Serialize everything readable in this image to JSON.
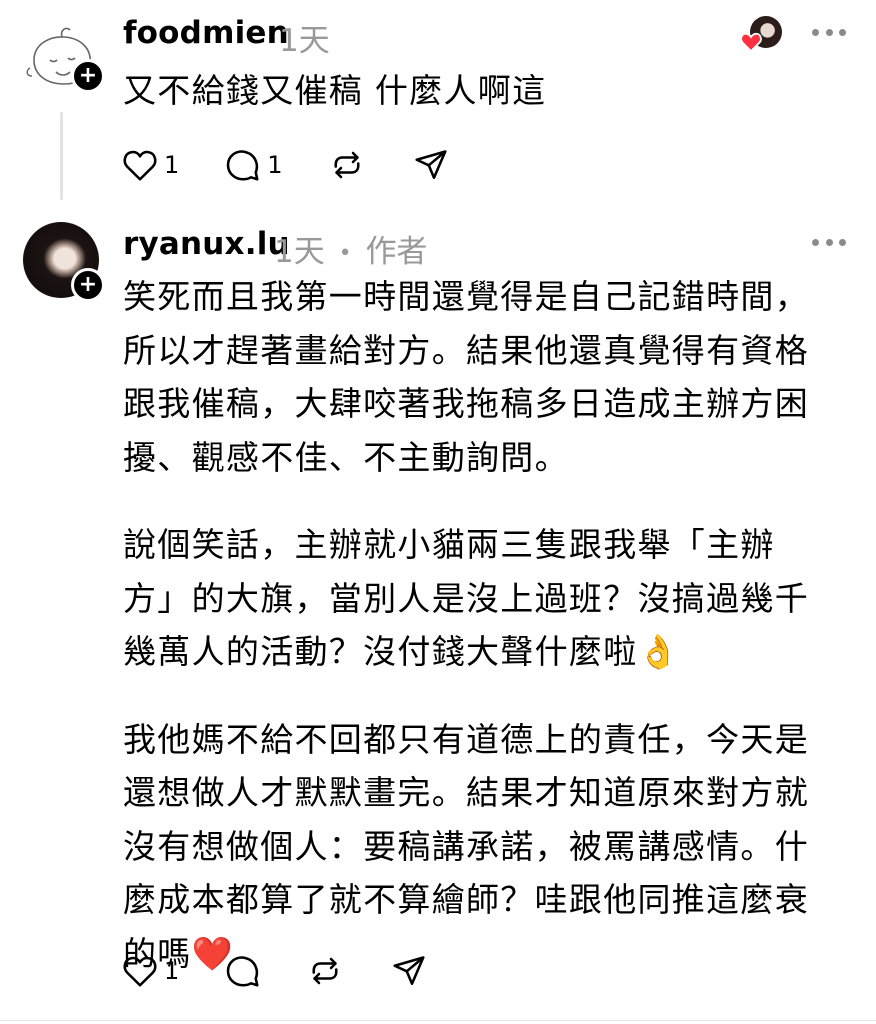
{
  "comment1": {
    "username": "foodmien",
    "time": "1天",
    "text": "又不給錢又催稿 什麼人啊這",
    "likes": "1",
    "replies": "1"
  },
  "comment2": {
    "username": "ryanux.lu",
    "time": "1天",
    "separator": "•",
    "author_badge": "作者",
    "paragraphs": [
      [
        "笑死而且我第一時間還覺得是自己記錯時間，",
        "所以才趕著畫給對方。結果他還真覺得有資格",
        "跟我催稿，大肆咬著我拖稿多日造成主辦方困",
        "擾、觀感不佳、不主動詢問。"
      ],
      [
        "說個笑話，主辦就小貓兩三隻跟我舉「主辦",
        "方」的大旗，當別人是沒上過班？沒搞過幾千",
        "幾萬人的活動？沒付錢大聲什麼啦👌"
      ],
      [
        "我他媽不給不回都只有道德上的責任，今天是",
        "還想做人才默默畫完。結果才知道原來對方就",
        "沒有想做個人：要稿講承諾，被罵講感情。什",
        "麼成本都算了就不算繪師？哇跟他同推這麼衰",
        "的嗎❤️"
      ]
    ],
    "likes": "1"
  },
  "colors": {
    "text": "#000000",
    "muted": "#999999",
    "heart": "#ff3040",
    "divider": "#e3e3e3"
  },
  "icons": [
    "plus-icon",
    "heart-icon",
    "comment-icon",
    "repost-icon",
    "share-icon",
    "more-icon"
  ]
}
